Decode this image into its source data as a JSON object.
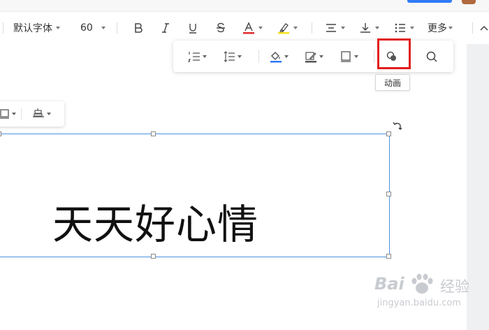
{
  "toolbar": {
    "font_family": "默认字体",
    "font_size": "60",
    "more_label": "更多",
    "font_color": "#e02b2b",
    "highlight_color": "#f5e21c"
  },
  "float_toolbar": {
    "fill_color": "#2f7bf5",
    "items": [
      "numbered-list",
      "line-spacing",
      "fill",
      "border-style",
      "shadow",
      "animation",
      "search"
    ]
  },
  "tooltip": {
    "text": "动画"
  },
  "mini_toolbar": {
    "items": [
      "border",
      "align"
    ]
  },
  "textbox": {
    "text": "天天好心情"
  },
  "watermark": {
    "line1": "Bai",
    "line2": "经验",
    "line3": "jingyan.baidu.com"
  }
}
